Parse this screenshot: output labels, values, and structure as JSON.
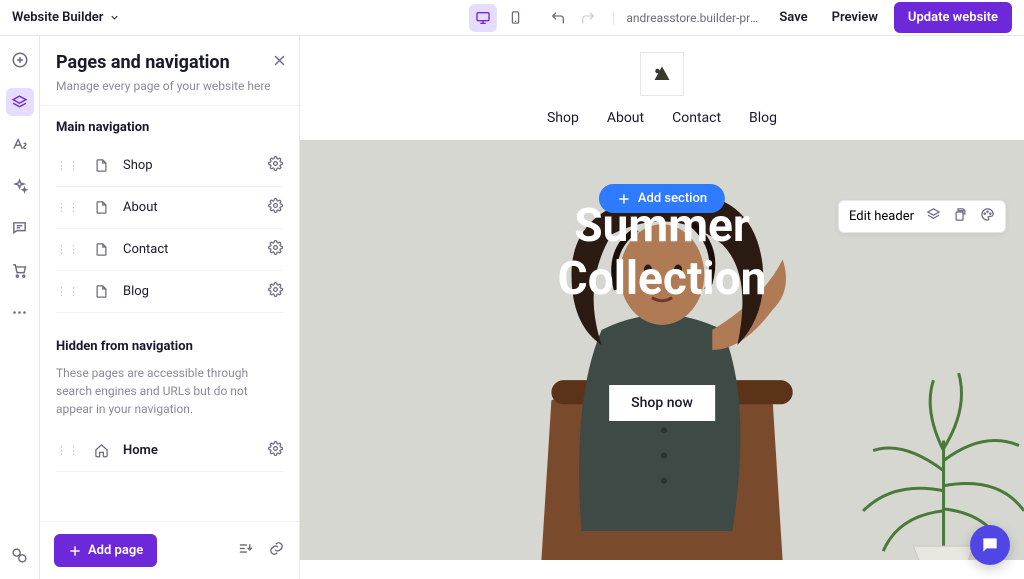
{
  "topbar": {
    "title": "Website Builder",
    "url": "andreasstore.builder-preview...",
    "save": "Save",
    "preview": "Preview",
    "update": "Update website"
  },
  "panel": {
    "title": "Pages and navigation",
    "subtitle": "Manage every page of your website here",
    "main_nav_label": "Main navigation",
    "pages": [
      {
        "label": "Shop"
      },
      {
        "label": "About"
      },
      {
        "label": "Contact"
      },
      {
        "label": "Blog"
      }
    ],
    "hidden_label": "Hidden from navigation",
    "hidden_desc": "These pages are accessible through search engines and URLs but do not appear in your navigation.",
    "hidden_pages": [
      {
        "label": "Home"
      }
    ],
    "add_page": "Add page"
  },
  "canvas": {
    "nav": [
      "Shop",
      "About",
      "Contact",
      "Blog"
    ],
    "add_section": "Add section",
    "edit_header": "Edit header",
    "hero_line1": "Summer",
    "hero_line2": "Collection",
    "hero_btn": "Shop now"
  },
  "colors": {
    "primary": "#6d28d9",
    "blue": "#2f7bff"
  }
}
